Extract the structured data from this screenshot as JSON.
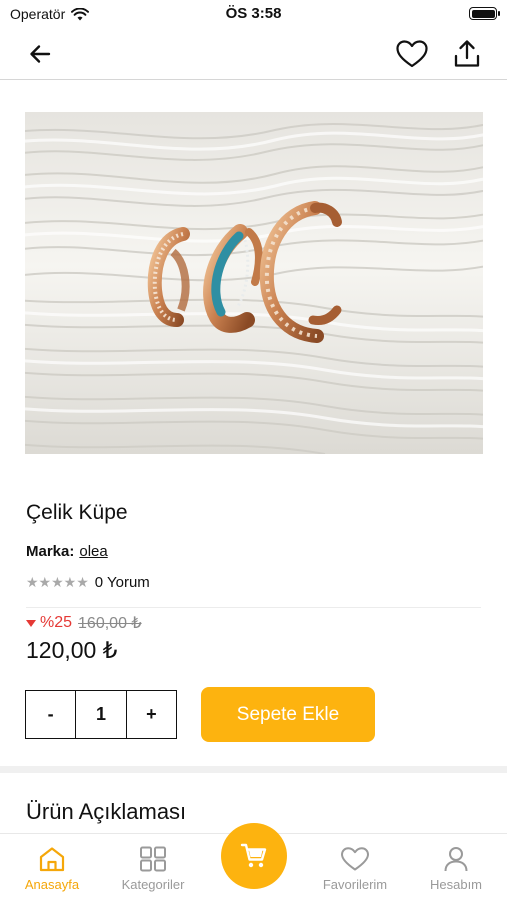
{
  "status_bar": {
    "carrier": "Operatör",
    "time": "ÖS 3:58"
  },
  "navbar": {
    "back_icon": "arrow-left-icon",
    "favorite_icon": "heart-outline-icon",
    "share_icon": "share-upload-icon"
  },
  "product": {
    "title": "Çelik Küpe",
    "brand_label": "Marka:",
    "brand_name": "olea",
    "rating_stars": "★★★★★",
    "review_count": "0 Yorum",
    "discount": "%25",
    "old_price": "160,00 ₺",
    "price": "120,00 ₺",
    "image_subject": "gold hoop earrings with turquoise enamel on white pleated fabric"
  },
  "quantity": {
    "minus": "-",
    "value": "1",
    "plus": "+"
  },
  "add_to_cart": "Sepete Ekle",
  "description_title": "Ürün Açıklaması",
  "tabbar": {
    "items": [
      {
        "label": "Anasayfa",
        "icon": "home-icon",
        "active": true
      },
      {
        "label": "Kategoriler",
        "icon": "grid-icon",
        "active": false
      },
      {
        "label": "Favorilerim",
        "icon": "heart-icon",
        "active": false
      },
      {
        "label": "Hesabım",
        "icon": "user-icon",
        "active": false
      }
    ],
    "cart_icon": "cart-icon"
  },
  "colors": {
    "accent": "#fdb30f",
    "accent_text": "#f5a70a",
    "discount": "#e53935",
    "muted": "#9a9a9a"
  }
}
